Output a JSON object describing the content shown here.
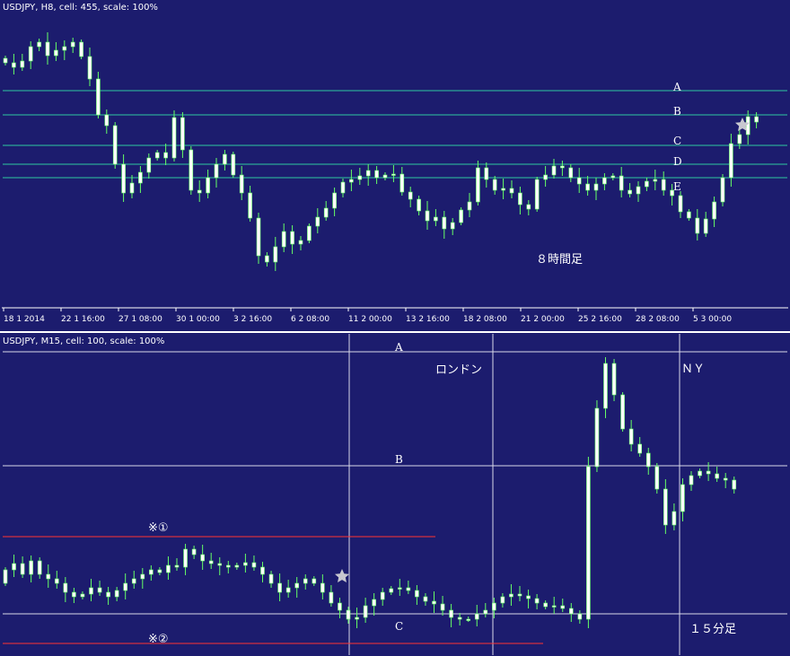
{
  "colors": {
    "background": "#1c1c6e",
    "candle_body_up": "#ffffff",
    "candle_body_down": "#ffffff",
    "wick": "#66ff66",
    "h8_level_lines": "#2ec7a0",
    "m15_level_lines": "#d8d8e8",
    "session_lines": "#d8d8e8",
    "red_lines": "#ff3333",
    "separator": "#ffffff"
  },
  "top_panel": {
    "info": "USDJPY, H8, cell: 455, scale: 100%",
    "timeframe_note": "８時間足",
    "level_labels": [
      "A",
      "B",
      "C",
      "D",
      "E"
    ],
    "x_ticks": [
      "18 1 2014",
      "22 1 16:00",
      "27 1 08:00",
      "30 1 00:00",
      "3 2 16:00",
      "6 2 08:00",
      "11 2 00:00",
      "13 2 16:00",
      "18 2 08:00",
      "21 2 00:00",
      "25 2 16:00",
      "28 2 08:00",
      "5 3 00:00"
    ],
    "marker_icon": "star-icon"
  },
  "bottom_panel": {
    "info": "USDJPY, M15, cell: 100, scale: 100%",
    "timeframe_note": "１５分足",
    "level_labels": [
      "A",
      "B",
      "C"
    ],
    "session_labels": [
      "ロンドン",
      "ＮＹ"
    ],
    "red_line_labels": [
      "※①",
      "※②"
    ],
    "marker_icon": "star-icon"
  }
}
